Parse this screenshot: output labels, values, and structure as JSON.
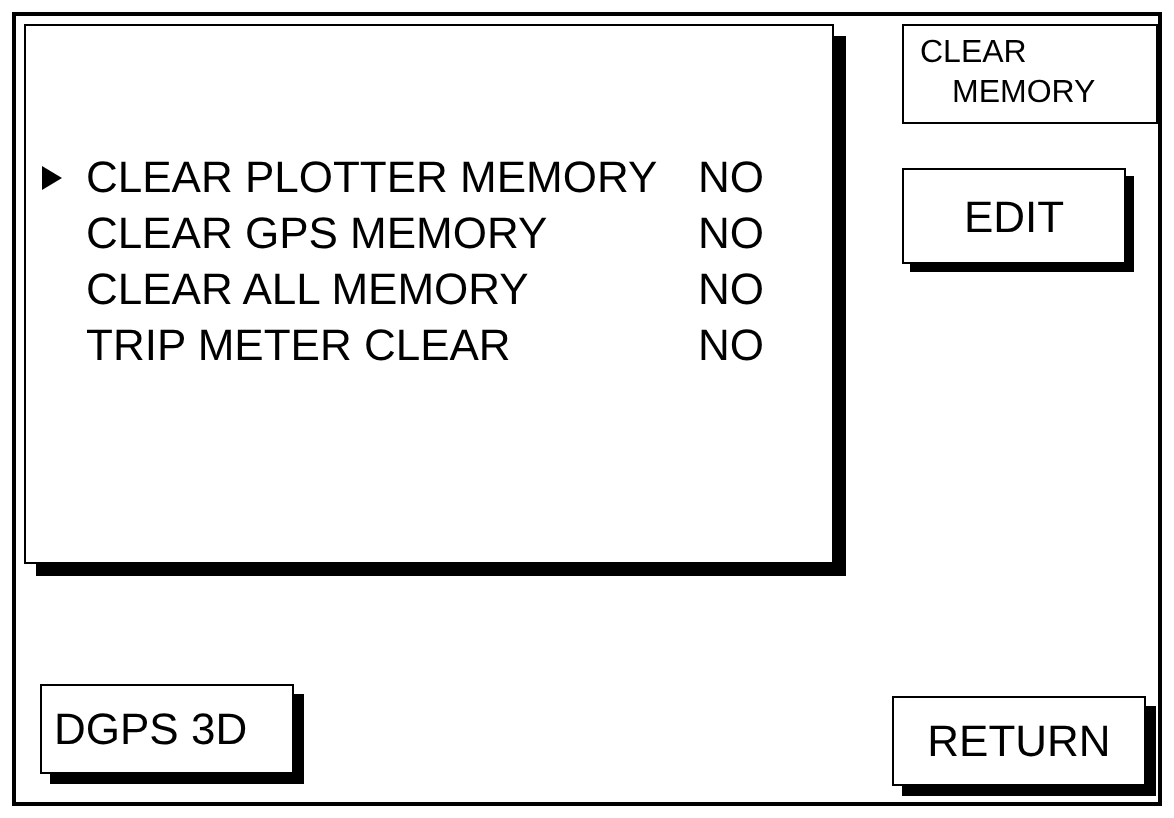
{
  "menu": {
    "items": [
      {
        "label": "CLEAR PLOTTER MEMORY",
        "value": "NO",
        "selected": true
      },
      {
        "label": "CLEAR GPS MEMORY",
        "value": "NO",
        "selected": false
      },
      {
        "label": "CLEAR ALL MEMORY",
        "value": "NO",
        "selected": false
      },
      {
        "label": "TRIP METER CLEAR",
        "value": "NO",
        "selected": false
      }
    ]
  },
  "title": {
    "lines": [
      "CLEAR",
      "MEMORY"
    ]
  },
  "buttons": {
    "edit": "EDIT",
    "status": "DGPS 3D",
    "return": "RETURN"
  }
}
